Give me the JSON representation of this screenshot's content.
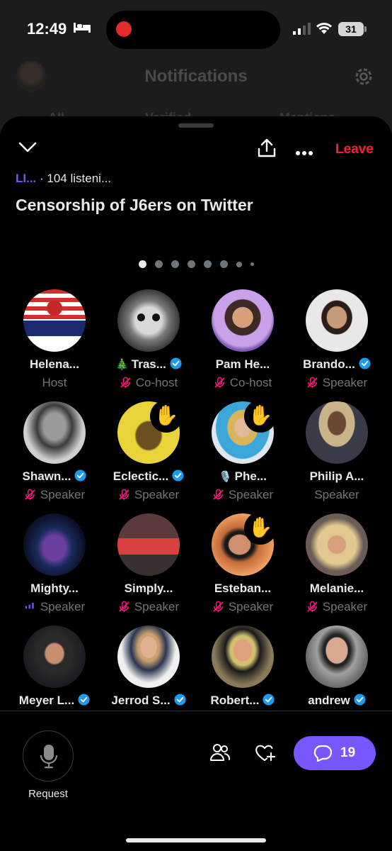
{
  "status_bar": {
    "time": "12:49",
    "battery": "31"
  },
  "background_page": {
    "title": "Notifications",
    "tabs": [
      "All",
      "Verified",
      "Mentions"
    ]
  },
  "space": {
    "live_label": "LI...",
    "listeners": "· 104 listeni...",
    "title": "Censorship of J6ers on Twitter",
    "leave_label": "Leave"
  },
  "participants": [
    {
      "name": "Helena...",
      "role": "Host",
      "verified": false,
      "mic": "none",
      "hand": false,
      "prefix": ""
    },
    {
      "name": "Tras...",
      "role": "Co-host",
      "verified": true,
      "mic": "muted",
      "hand": false,
      "prefix": "🎄"
    },
    {
      "name": "Pam He...",
      "role": "Co-host",
      "verified": false,
      "mic": "muted",
      "hand": false,
      "prefix": ""
    },
    {
      "name": "Brando...",
      "role": "Speaker",
      "verified": true,
      "mic": "muted",
      "hand": false,
      "prefix": ""
    },
    {
      "name": "Shawn...",
      "role": "Speaker",
      "verified": true,
      "mic": "muted",
      "hand": false,
      "prefix": ""
    },
    {
      "name": "Eclectic...",
      "role": "Speaker",
      "verified": true,
      "mic": "muted",
      "hand": true,
      "prefix": ""
    },
    {
      "name": "Phe...",
      "role": "Speaker",
      "verified": false,
      "mic": "muted",
      "hand": true,
      "prefix": "🎙️"
    },
    {
      "name": "Philip A...",
      "role": "Speaker",
      "verified": false,
      "mic": "none",
      "hand": false,
      "prefix": ""
    },
    {
      "name": "Mighty...",
      "role": "Speaker",
      "verified": false,
      "mic": "speaking",
      "hand": false,
      "prefix": ""
    },
    {
      "name": "Simply...",
      "role": "Speaker",
      "verified": false,
      "mic": "muted",
      "hand": false,
      "prefix": ""
    },
    {
      "name": "Esteban...",
      "role": "Speaker",
      "verified": false,
      "mic": "muted",
      "hand": true,
      "prefix": ""
    },
    {
      "name": "Melanie...",
      "role": "Speaker",
      "verified": false,
      "mic": "muted",
      "hand": false,
      "prefix": ""
    },
    {
      "name": "Meyer L...",
      "role": "",
      "verified": true,
      "mic": "none",
      "hand": false,
      "prefix": ""
    },
    {
      "name": "Jerrod S...",
      "role": "",
      "verified": true,
      "mic": "none",
      "hand": false,
      "prefix": ""
    },
    {
      "name": "Robert...",
      "role": "",
      "verified": true,
      "mic": "none",
      "hand": false,
      "prefix": ""
    },
    {
      "name": "andrew",
      "role": "",
      "verified": true,
      "mic": "none",
      "hand": false,
      "prefix": ""
    }
  ],
  "avatar_art": [
    "investigate-j6-logo",
    "raccoon",
    "illustrated-woman",
    "man-portrait",
    "bald-man",
    "gadsden-flag",
    "blonde-woman",
    "man-in-suit",
    "thor-art",
    "team-maslow-sign",
    "man-sunglasses",
    "blonde-woman-2",
    "man-glasses",
    "man-suit-tie",
    "man-outdoors",
    "man-glasses-2"
  ],
  "hand_emoji": "✋",
  "bottom_bar": {
    "request_label": "Request",
    "comment_count": "19"
  },
  "colors": {
    "accent": "#7856ff",
    "leave": "#f4212e",
    "verified": "#1d9bf0",
    "muted": "#f91880",
    "hand_bg": "#000000"
  }
}
